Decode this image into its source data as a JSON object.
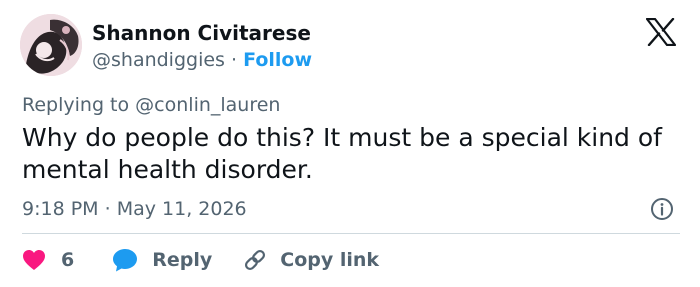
{
  "author": {
    "display_name": "Shannon Civitarese",
    "handle": "@shandiggies",
    "separator": "·",
    "follow_label": "Follow"
  },
  "brand": {
    "icon": "x-logo-icon"
  },
  "tweet": {
    "replying_to_prefix": "Replying to",
    "replying_to_handle": "@conlin_lauren",
    "text": "Why do people do this? It must be a special kind of mental health disorder.",
    "time": "9:18 PM",
    "separator": "·",
    "date": "May 11, 2026"
  },
  "actions": {
    "like_count": "6",
    "reply_label": "Reply",
    "copy_link_label": "Copy link"
  },
  "colors": {
    "text_primary": "#0f1419",
    "text_secondary": "#536471",
    "link": "#1d9bf0",
    "heart": "#f91880",
    "divider": "#cfd9de"
  }
}
